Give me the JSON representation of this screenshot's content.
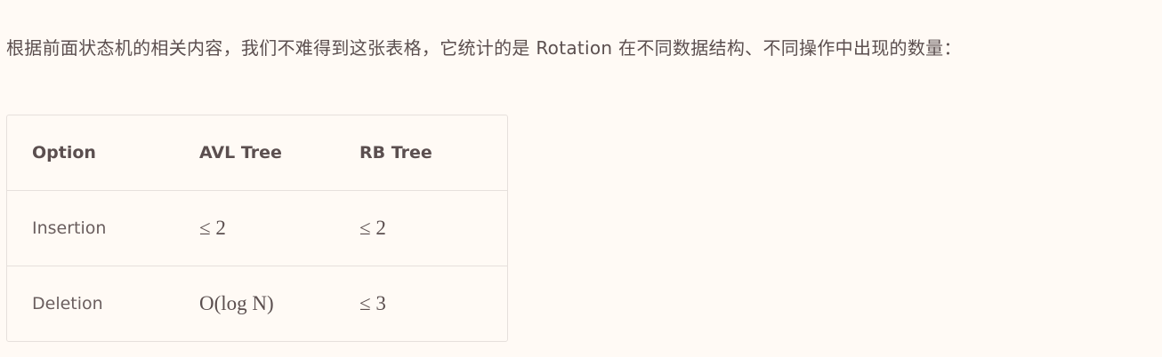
{
  "paragraph": "根据前面状态机的相关内容，我们不难得到这张表格，它统计的是 Rotation 在不同数据结构、不同操作中出现的数量：",
  "table": {
    "headers": [
      "Option",
      "AVL Tree",
      "RB Tree"
    ],
    "rows": [
      [
        "Insertion",
        "≤ 2",
        "≤ 2"
      ],
      [
        "Deletion",
        "O(log N)",
        "≤ 3"
      ]
    ]
  }
}
